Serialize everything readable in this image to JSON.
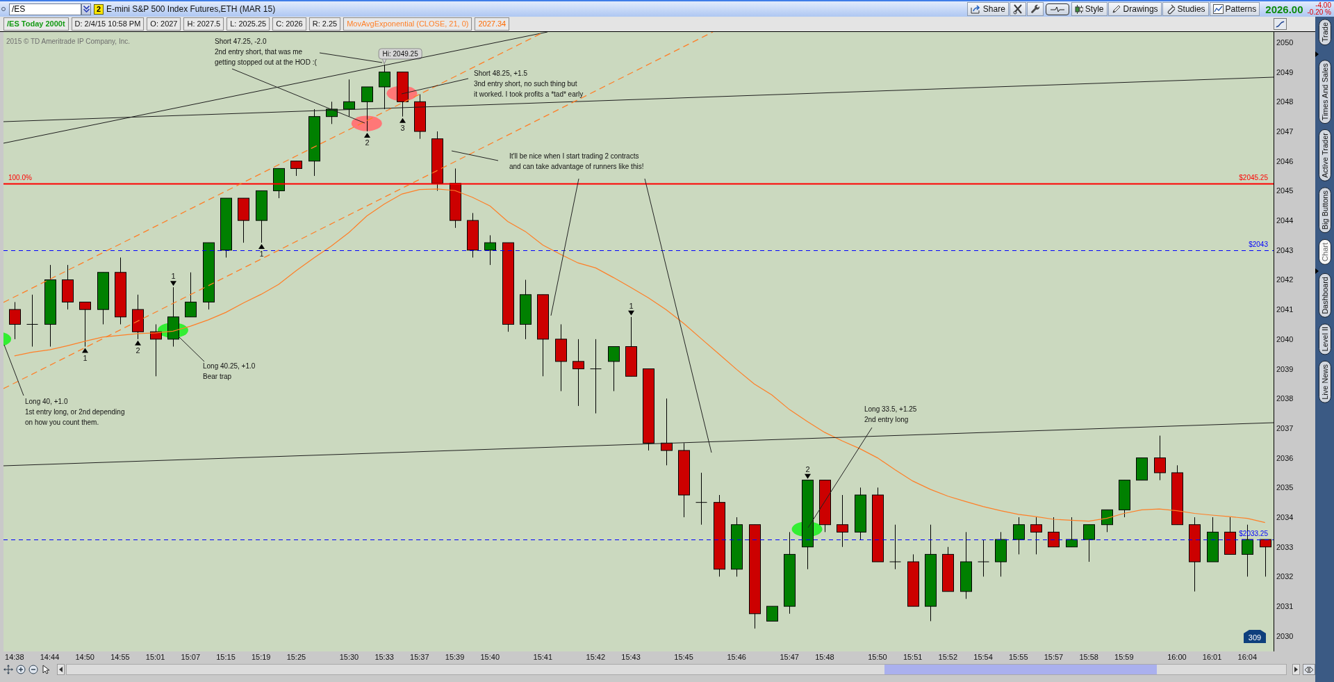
{
  "toolbar": {
    "symbol": "/ES",
    "link_group": "2",
    "description": "E-mini S&P 500 Index Futures,ETH (MAR 15)",
    "buttons": [
      {
        "kind": "share",
        "label": "Share"
      },
      {
        "kind": "tools"
      },
      {
        "kind": "wrench"
      },
      {
        "kind": "pulse"
      },
      {
        "kind": "style",
        "label": "Style"
      },
      {
        "kind": "drawings",
        "label": "Drawings"
      },
      {
        "kind": "studies",
        "label": "Studies"
      },
      {
        "kind": "patterns",
        "label": "Patterns"
      }
    ],
    "last_price": "2026.00",
    "net_change": "-4.00",
    "percent_change": "-0.20 %"
  },
  "info_strip": {
    "title": "/ES Today 2000t",
    "fields": [
      "D: 2/4/15 10:58 PM",
      "O: 2027",
      "H: 2027.5",
      "L: 2025.25",
      "C: 2026",
      "R: 2.25"
    ],
    "study_value": "2027.34"
  },
  "chart": {
    "copyright": "2015 © TD Ameritrade IP Company, Inc.",
    "chart_data": {
      "type": "candlestick",
      "categories": [
        "14:38",
        null,
        "14:44",
        null,
        "14:50",
        null,
        "14:55",
        null,
        "15:01",
        null,
        "15:07",
        null,
        "15:15",
        null,
        "15:19",
        null,
        "15:25",
        null,
        null,
        "15:30",
        null,
        "15:33",
        null,
        "15:37",
        null,
        "15:39",
        null,
        "15:40",
        null,
        null,
        "15:41",
        null,
        null,
        "15:42",
        null,
        "15:43",
        null,
        null,
        "15:45",
        null,
        null,
        "15:46",
        null,
        null,
        "15:47",
        null,
        "15:48",
        null,
        null,
        "15:50",
        null,
        "15:51",
        null,
        "15:52",
        null,
        "15:54",
        null,
        "15:55",
        null,
        "15:57",
        null,
        "15:58",
        null,
        "15:59",
        null,
        null,
        "16:00",
        null,
        "16:01",
        null,
        "16:04",
        null
      ],
      "ohlc": [
        [
          2041,
          2041.25,
          2040,
          2040.5
        ],
        [
          2040.5,
          2041.5,
          2039.75,
          2040.5
        ],
        [
          2040.5,
          2042.5,
          2039.75,
          2042
        ],
        [
          2042,
          2042.5,
          2041,
          2041.25
        ],
        [
          2041.25,
          2041.25,
          2039.75,
          2041
        ],
        [
          2041,
          2042.25,
          2040.5,
          2042.25
        ],
        [
          2042.25,
          2042.75,
          2040.5,
          2040.75
        ],
        [
          2041,
          2041.5,
          2040,
          2040.25
        ],
        [
          2040.25,
          2040.5,
          2038.75,
          2040
        ],
        [
          2040,
          2041.75,
          2039.75,
          2040.75
        ],
        [
          2040.75,
          2042.25,
          2040.75,
          2041.25
        ],
        [
          2041.25,
          2043.25,
          2041,
          2043.25
        ],
        [
          2043,
          2044.75,
          2042.75,
          2044.75
        ],
        [
          2044.75,
          2044.75,
          2043.25,
          2044
        ],
        [
          2044,
          2045,
          2043.25,
          2045
        ],
        [
          2045,
          2045.75,
          2044.75,
          2045.75
        ],
        [
          2046,
          2046,
          2045.5,
          2045.75
        ],
        [
          2046,
          2047.75,
          2045.5,
          2047.5
        ],
        [
          2047.5,
          2048,
          2047.25,
          2047.75
        ],
        [
          2047.75,
          2048.75,
          2047.5,
          2048
        ],
        [
          2048,
          2048.5,
          2047,
          2048.5
        ],
        [
          2048.5,
          2049.25,
          2047.75,
          2049
        ],
        [
          2049,
          2049,
          2047.5,
          2048
        ],
        [
          2048,
          2048.25,
          2046.75,
          2047
        ],
        [
          2046.75,
          2047,
          2045,
          2045.25
        ],
        [
          2045.25,
          2045.75,
          2043.75,
          2044
        ],
        [
          2044,
          2044.25,
          2042.75,
          2043
        ],
        [
          2043,
          2043.5,
          2042.5,
          2043.25
        ],
        [
          2043.25,
          2043.25,
          2040.25,
          2040.5
        ],
        [
          2040.5,
          2042,
          2040,
          2041.5
        ],
        [
          2041.5,
          2041.5,
          2038.75,
          2040
        ],
        [
          2040,
          2040.5,
          2038.25,
          2039.25
        ],
        [
          2039.25,
          2040,
          2037.75,
          2039
        ],
        [
          2039,
          2040,
          2037.5,
          2039
        ],
        [
          2039.25,
          2039.75,
          2038.25,
          2039.75
        ],
        [
          2039.75,
          2040.75,
          2038.75,
          2038.75
        ],
        [
          2039,
          2039,
          2036.25,
          2036.5
        ],
        [
          2036.5,
          2038,
          2035.75,
          2036.25
        ],
        [
          2036.25,
          2036.5,
          2034,
          2034.75
        ],
        [
          2034.5,
          2035.5,
          2033.75,
          2034.5
        ],
        [
          2034.5,
          2034.75,
          2032,
          2032.25
        ],
        [
          2032.25,
          2034,
          2032,
          2033.75
        ],
        [
          2033.75,
          2033.75,
          2030.25,
          2030.75
        ],
        [
          2030.5,
          2031,
          2030.5,
          2031
        ],
        [
          2031,
          2033.5,
          2030.75,
          2032.75
        ],
        [
          2033,
          2035.25,
          2032.25,
          2035.25
        ],
        [
          2035.25,
          2035.25,
          2033.5,
          2033.75
        ],
        [
          2033.75,
          2034.75,
          2033,
          2033.5
        ],
        [
          2033.5,
          2035,
          2033.25,
          2034.75
        ],
        [
          2034.75,
          2035,
          2032.5,
          2032.5
        ],
        [
          2032.5,
          2033.75,
          2032.25,
          2032.5
        ],
        [
          2032.5,
          2032.75,
          2031,
          2031
        ],
        [
          2031,
          2033.75,
          2030.5,
          2032.75
        ],
        [
          2032.75,
          2033,
          2031.5,
          2031.5
        ],
        [
          2031.5,
          2033.5,
          2031.25,
          2032.5
        ],
        [
          2032.5,
          2033.25,
          2032,
          2032.5
        ],
        [
          2032.5,
          2033.5,
          2032,
          2033.25
        ],
        [
          2033.25,
          2034,
          2032.75,
          2033.75
        ],
        [
          2033.75,
          2034,
          2032.75,
          2033.5
        ],
        [
          2033.5,
          2034,
          2033,
          2033
        ],
        [
          2033,
          2034,
          2033,
          2033.25
        ],
        [
          2033.25,
          2033.75,
          2032.5,
          2033.75
        ],
        [
          2033.75,
          2034.25,
          2033.5,
          2034.25
        ],
        [
          2034.25,
          2035.25,
          2034,
          2035.25
        ],
        [
          2035.25,
          2036,
          2035.25,
          2036
        ],
        [
          2036,
          2036.75,
          2035.25,
          2035.5
        ],
        [
          2035.5,
          2035.75,
          2033.75,
          2033.75
        ],
        [
          2033.75,
          2034,
          2031.5,
          2032.5
        ],
        [
          2032.5,
          2034,
          2032.5,
          2033.5
        ],
        [
          2033.5,
          2034,
          2032.75,
          2032.75
        ],
        [
          2032.75,
          2033.75,
          2032,
          2033.25
        ],
        [
          2033.25,
          2033.25,
          2032,
          2033
        ]
      ],
      "series": [
        {
          "name": "MovAvgExponential (CLOSE, 21, 0)",
          "type": "line",
          "color": "#ff7f27",
          "values": [
            2039.44,
            2039.56,
            2039.64,
            2039.78,
            2039.93,
            2040.07,
            2040.13,
            2040.19,
            2040.21,
            2040.27,
            2040.44,
            2040.65,
            2040.9,
            2041.22,
            2041.51,
            2041.85,
            2042.31,
            2042.74,
            2043.14,
            2043.6,
            2044.15,
            2044.55,
            2044.89,
            2045.04,
            2045.06,
            2045.01,
            2044.78,
            2044.49,
            2043.97,
            2043.63,
            2043.17,
            2042.86,
            2042.57,
            2042.4,
            2042.08,
            2041.74,
            2041.39,
            2040.99,
            2040.53,
            2040.01,
            2039.5,
            2038.98,
            2038.49,
            2038.12,
            2037.63,
            2037.23,
            2036.86,
            2036.57,
            2036.31,
            2036.0,
            2035.6,
            2035.22,
            2034.94,
            2034.71,
            2034.53,
            2034.36,
            2034.22,
            2034.1,
            2034.02,
            2033.93,
            2033.9,
            2033.87,
            2033.96,
            2034.13,
            2034.25,
            2034.28,
            2034.22,
            2034.13,
            2034.07,
            2034.02,
            2033.96,
            2033.82
          ]
        }
      ],
      "ylim": [
        2029.48,
        2050.35
      ],
      "yticks": [
        2030,
        2031,
        2032,
        2033,
        2034,
        2035,
        2036,
        2037,
        2038,
        2039,
        2040,
        2041,
        2042,
        2043,
        2044,
        2045,
        2046,
        2047,
        2048,
        2049,
        2050
      ],
      "ref_lines": [
        {
          "axis": "y",
          "value": 2045.25,
          "label": "$2045.25",
          "color": "#ff0000"
        },
        {
          "axis": "y",
          "value": 2043,
          "label": "$2043",
          "color": "#0000ff"
        },
        {
          "axis": "y",
          "value": 2033.25,
          "label": "$2033.25",
          "color": "#0000ff"
        }
      ],
      "annotations": [
        "Hi: 2049.25",
        "100.0%",
        {
          "text": "1",
          "y": 2039.75
        },
        {
          "text": "2",
          "y": 2040
        },
        {
          "text": "1",
          "y": 2041.75
        },
        {
          "text": "1",
          "y": 2043.25
        },
        {
          "text": "2",
          "y": 2047
        },
        {
          "text": "3",
          "y": 2047.5
        },
        {
          "text": "1",
          "y": 2040.75
        },
        {
          "text": "2",
          "y": 2035.25
        }
      ]
    },
    "highlights": [
      {
        "color": "#33ee33"
      },
      {
        "color": "#33ee33"
      },
      {
        "color": "#ff7777"
      },
      {
        "color": "#ff7777"
      },
      {
        "color": "#33ee33"
      }
    ],
    "notes": [
      {
        "lines": [
          "Short 47.25, -2.0",
          "2nd entry short, that was me",
          "getting stopped out at the HOD :("
        ]
      },
      {
        "lines": [
          "Short 48.25, +1.5",
          "3nd entry short, no such thing but",
          "it worked. I took profits a *tad* early"
        ]
      },
      {
        "lines": [
          "It'll be nice when I start trading 2 contracts",
          "and can take advantage of runners like this!"
        ]
      },
      {
        "lines": [
          "Long 40.25, +1.0",
          "Bear trap"
        ]
      },
      {
        "lines": [
          "Long 40, +1.0",
          "1st entry long, or 2nd depending",
          "on how you count them."
        ]
      },
      {
        "lines": [
          "Long 33.5, +1.25",
          "2nd entry long"
        ]
      }
    ],
    "bar_count": "309"
  },
  "sidebar": {
    "tabs": [
      {
        "label": "Trade",
        "selected": false
      },
      {
        "label": "Times And Sales",
        "selected": false
      },
      {
        "label": "Active Trader",
        "selected": false
      },
      {
        "label": "Big Buttons",
        "selected": false
      },
      {
        "label": "Chart",
        "selected": true
      },
      {
        "label": "Dashboard",
        "selected": false
      },
      {
        "label": "Level II",
        "selected": false
      },
      {
        "label": "Live News",
        "selected": false
      }
    ]
  }
}
